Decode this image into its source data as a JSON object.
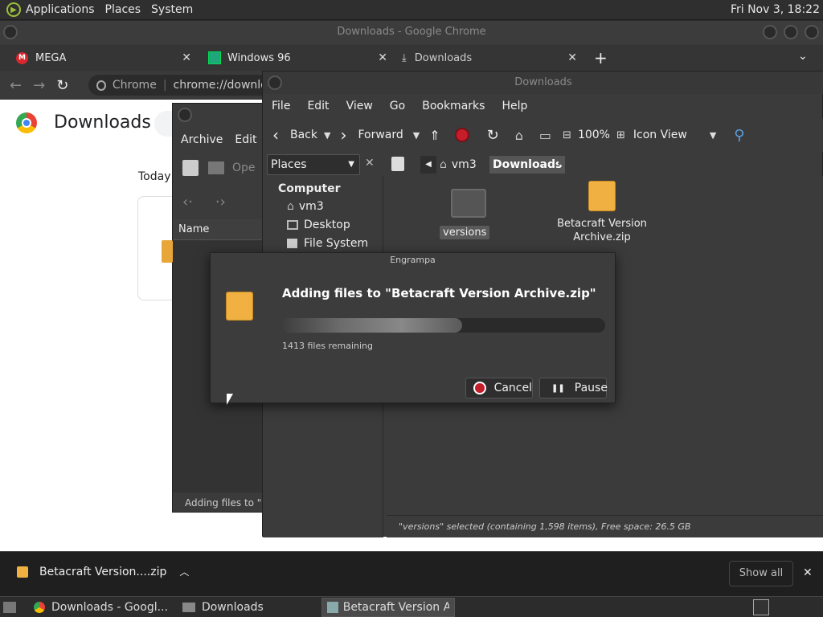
{
  "top_panel": {
    "menus": [
      "Applications",
      "Places",
      "System"
    ],
    "clock": "Fri Nov  3, 18:22"
  },
  "chrome": {
    "title": "Downloads - Google Chrome",
    "tabs": [
      {
        "label": "MEGA"
      },
      {
        "label": "Windows 96"
      },
      {
        "label": "Downloads"
      }
    ],
    "omnibox": {
      "site": "Chrome",
      "url": "chrome://downloads"
    },
    "page": {
      "title": "Downloads",
      "today": "Today"
    },
    "shelf": {
      "file": "Betacraft Version....zip",
      "show_all": "Show all"
    }
  },
  "engrampa_back": {
    "menu": [
      "Archive",
      "Edit"
    ],
    "open": "Ope",
    "column": "Name",
    "status": "Adding files to \"Beta"
  },
  "caja": {
    "title": "Downloads",
    "menu": [
      "File",
      "Edit",
      "View",
      "Go",
      "Bookmarks",
      "Help"
    ],
    "toolbar": {
      "back": "Back",
      "forward": "Forward",
      "zoom": "100%",
      "view": "Icon View"
    },
    "places": "Places",
    "breadcrumb": [
      "vm3",
      "Downloads"
    ],
    "sidebar": {
      "heading": "Computer",
      "items": [
        "vm3",
        "Desktop",
        "File System"
      ]
    },
    "items": [
      {
        "name": "versions"
      },
      {
        "name": "Betacraft Version Archive.zip"
      }
    ],
    "status": "\"versions\" selected (containing 1,598 items), Free space: 26.5 GB"
  },
  "dialog": {
    "title": "Engrampa",
    "heading": "Adding files to \"Betacraft Version Archive.zip\"",
    "progress": 0.56,
    "remaining": "1413 files remaining",
    "cancel": "Cancel",
    "pause": "Pause"
  },
  "taskbar": {
    "tasks": [
      "Downloads - Googl...",
      "Downloads",
      "Betacraft Version Ar..."
    ]
  }
}
